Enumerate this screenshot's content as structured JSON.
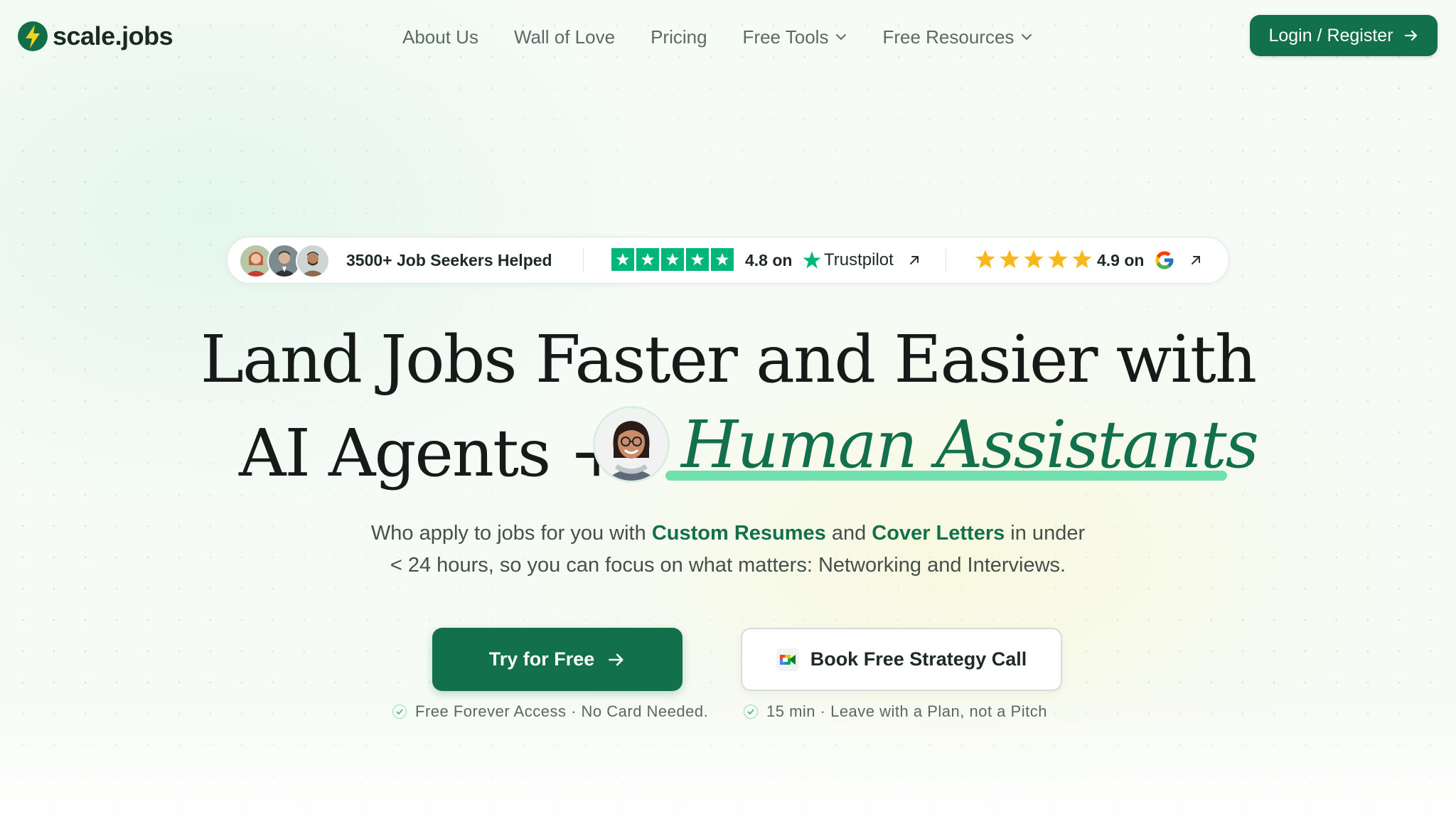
{
  "header": {
    "logo_text": "scale.jobs",
    "nav": [
      {
        "label": "About Us"
      },
      {
        "label": "Wall of Love"
      },
      {
        "label": "Pricing"
      },
      {
        "label": "Free Tools",
        "dropdown": true
      },
      {
        "label": "Free Resources",
        "dropdown": true
      }
    ],
    "login_label": "Login / Register"
  },
  "social_proof": {
    "helped_text": "3500+ Job Seekers Helped",
    "trustpilot_rating": "4.8 on",
    "trustpilot_brand": "Trustpilot",
    "google_rating": "4.9 on"
  },
  "hero": {
    "title_line1": "Land Jobs Faster and Easier with",
    "title_line2_prefix": "AI Agents +",
    "title_highlight": "Human Assistants",
    "subtitle_part1": "Who apply to jobs for you with ",
    "subtitle_highlight1": "Custom Resumes",
    "subtitle_part2": " and ",
    "subtitle_highlight2": "Cover Letters",
    "subtitle_part3": " in under",
    "subtitle_line2": "< 24 hours, so you can focus on what matters: Networking and Interviews."
  },
  "cta": {
    "primary_label": "Try for Free",
    "primary_note": "Free Forever Access · No Card Needed.",
    "secondary_label": "Book Free Strategy Call",
    "secondary_note": "15 min · Leave with a Plan, not a Pitch"
  },
  "colors": {
    "brand_green": "#12704c",
    "highlight_underline": "#6fe0ae",
    "trustpilot_green": "#00b67a",
    "google_star": "#f8b819"
  },
  "icons": [
    "logo-bolt-icon",
    "chevron-down-icon",
    "arrow-right-icon",
    "trustpilot-star-icon",
    "arrow-up-right-icon",
    "star-icon",
    "google-g-icon",
    "google-meet-icon",
    "check-circle-icon"
  ]
}
